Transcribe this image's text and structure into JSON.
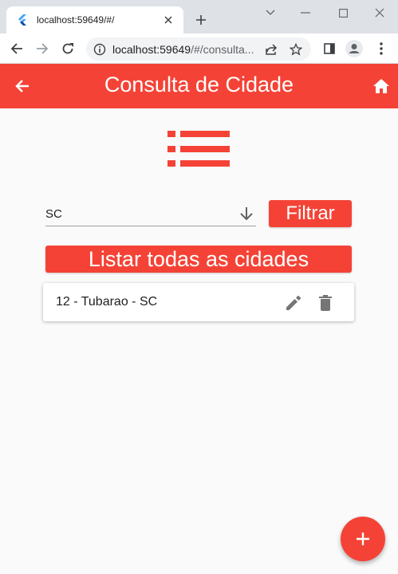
{
  "browser": {
    "tab_title": "localhost:59649/#/",
    "url_host": "localhost:59649",
    "url_path": "/#/consulta..."
  },
  "appbar": {
    "title": "Consulta de Cidade"
  },
  "filter": {
    "value": "SC",
    "button_label": "Filtrar"
  },
  "list_all_button_label": "Listar todas as cidades",
  "cities": [
    {
      "label": "12 - Tubarao - SC"
    }
  ],
  "icons": {
    "back": "arrow-back-icon",
    "home": "home-icon",
    "list": "list-icon",
    "dropdown": "arrow-down-icon",
    "edit": "edit-icon",
    "delete": "delete-icon",
    "add": "add-icon"
  },
  "colors": {
    "primary": "#f44336",
    "background": "#fafafa",
    "icon_grey": "#757575"
  }
}
